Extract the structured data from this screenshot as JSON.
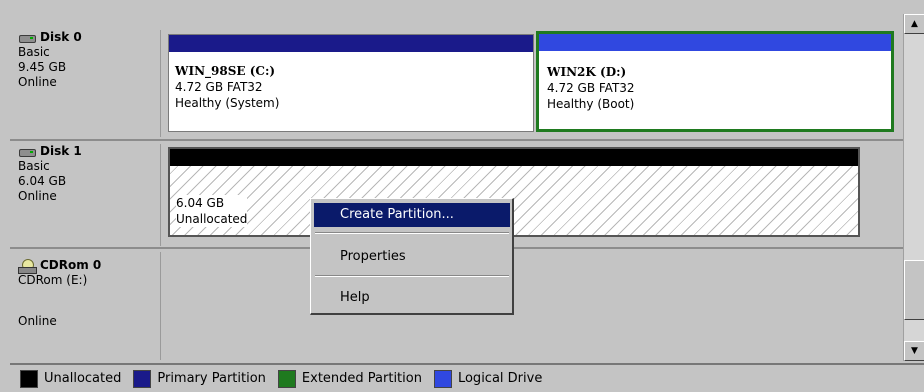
{
  "disks": [
    {
      "title": "Disk 0",
      "type": "Basic",
      "size": "9.45 GB",
      "status": "Online"
    },
    {
      "title": "Disk 1",
      "type": "Basic",
      "size": "6.04 GB",
      "status": "Online"
    },
    {
      "title": "CDRom 0",
      "type": "CDRom (E:)",
      "status": "Online"
    }
  ],
  "partitions": {
    "win98": {
      "name": "WIN_98SE  (C:)",
      "size": "4.72 GB FAT32",
      "status": "Healthy (System)"
    },
    "win2k": {
      "name": "WIN2K  (D:)",
      "size": "4.72 GB FAT32",
      "status": "Healthy (Boot)"
    },
    "unalloc": {
      "size": "6.04 GB",
      "status": "Unallocated"
    }
  },
  "context_menu": {
    "items": [
      "Create Partition...",
      "Properties",
      "Help"
    ],
    "selected": "Create Partition..."
  },
  "legend": [
    {
      "label": "Unallocated",
      "color": "#000000"
    },
    {
      "label": "Primary Partition",
      "color": "#1a1a8a"
    },
    {
      "label": "Extended Partition",
      "color": "#1f7a1f"
    },
    {
      "label": "Logical Drive",
      "color": "#3048e0"
    }
  ],
  "colors": {
    "primary": "#1a1a8a",
    "logical": "#3048e0",
    "extended": "#1f7a1f",
    "unallocated": "#000000",
    "menu_highlight": "#0a1a6a"
  },
  "icons": [
    "disk-icon",
    "cdrom-icon",
    "scroll-up-icon",
    "scroll-down-icon"
  ]
}
